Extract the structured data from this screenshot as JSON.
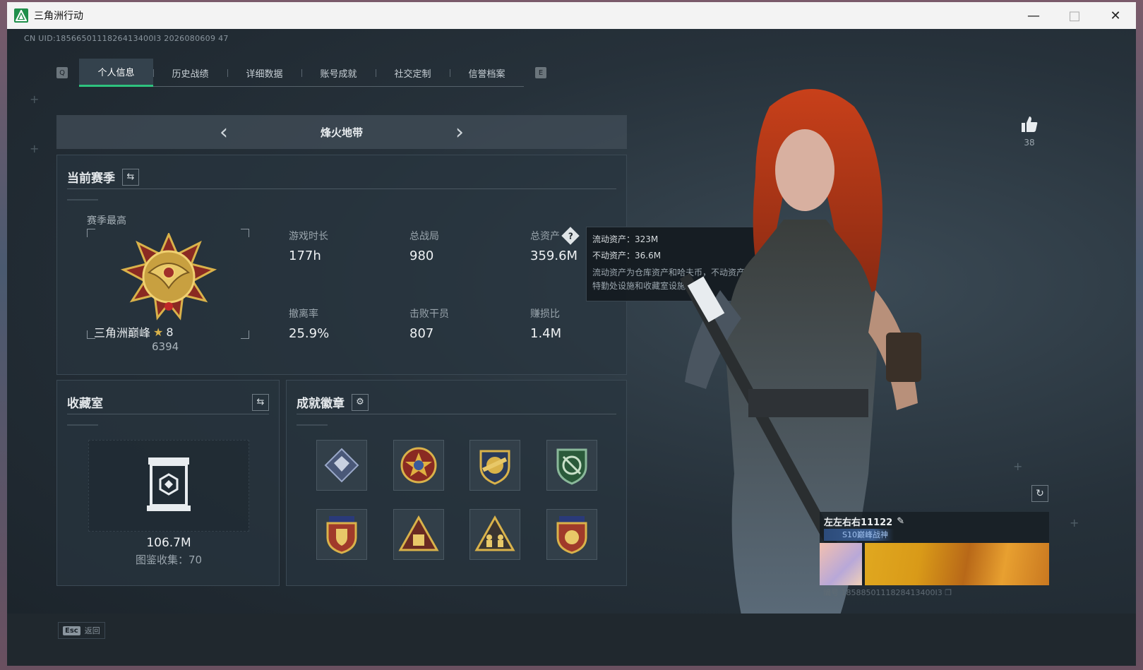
{
  "window": {
    "title": "三角洲行动"
  },
  "header": {
    "uid_line": "CN UID:1856650111826413400I3 2026080609 47"
  },
  "tabs": {
    "left_key": "Q",
    "right_key": "E",
    "items": [
      {
        "label": "个人信息",
        "active": true
      },
      {
        "label": "历史战绩"
      },
      {
        "label": "详细数据"
      },
      {
        "label": "账号成就"
      },
      {
        "label": "社交定制"
      },
      {
        "label": "信誉档案"
      }
    ]
  },
  "mode": {
    "title": "烽火地带"
  },
  "season": {
    "title": "当前赛季",
    "best_label": "赛季最高",
    "rank_name": "三角洲巅峰",
    "rank_stars": "8",
    "rank_score": "6394",
    "stats": {
      "playtime": {
        "label": "游戏时长",
        "value": "177h"
      },
      "matches": {
        "label": "总战局",
        "value": "980"
      },
      "assets": {
        "label": "总资产",
        "value": "359.6M"
      },
      "extract_rate": {
        "label": "撤离率",
        "value": "25.9%"
      },
      "kills": {
        "label": "击败干员",
        "value": "807"
      },
      "profit_ratio": {
        "label": "赚损比",
        "value": "1.4M"
      }
    }
  },
  "tooltip": {
    "liquid": "流动资产：323M",
    "fixed": "不动资产：36.6M",
    "desc": "流动资产为仓库资产和哈夫币，不动资产为特勤处设施和收藏室设施"
  },
  "collection": {
    "title": "收藏室",
    "value": "106.7M",
    "count": "图鉴收集：70"
  },
  "badges": {
    "title": "成就徽章",
    "items": [
      {
        "name": "crystal"
      },
      {
        "name": "star-shield"
      },
      {
        "name": "golden-crest"
      },
      {
        "name": "green-target"
      },
      {
        "name": "navy-shield"
      },
      {
        "name": "pyramid"
      },
      {
        "name": "triangle-figures"
      },
      {
        "name": "gold-shield"
      }
    ]
  },
  "like": {
    "count": "38"
  },
  "card": {
    "name": "左左右右11122",
    "tag": "S10巅峰战神",
    "id": "编号 1858850111828413400I3"
  },
  "footer": {
    "esc_key": "Esc",
    "esc_label": "返回"
  },
  "colors": {
    "accent": "#2ec27e",
    "background": "#1e262c",
    "gold": "#d9b24a"
  }
}
